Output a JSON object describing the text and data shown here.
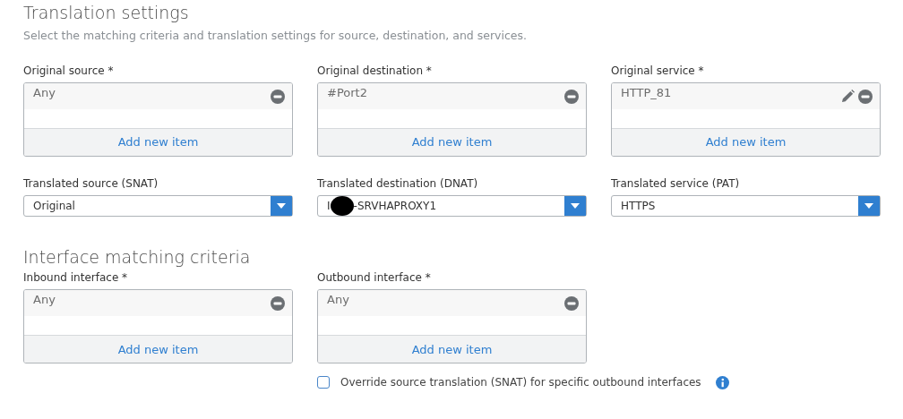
{
  "translation": {
    "title": "Translation settings",
    "description": "Select the matching criteria and translation settings for source, destination, and services.",
    "lists": [
      {
        "label": "Original source *",
        "items": [
          {
            "value": "Any",
            "editable": false
          }
        ],
        "add_label": "Add new item"
      },
      {
        "label": "Original destination *",
        "items": [
          {
            "value": "#Port2",
            "editable": false
          }
        ],
        "add_label": "Add new item"
      },
      {
        "label": "Original service *",
        "items": [
          {
            "value": "HTTP_81",
            "editable": true
          }
        ],
        "add_label": "Add new item"
      }
    ],
    "selects": [
      {
        "label": "Translated source (SNAT)",
        "value": "Original",
        "redacted": false
      },
      {
        "label": "Translated destination (DNAT)",
        "value": "I",
        "redacted": true,
        "value_after": "-SRVHAPROXY1"
      },
      {
        "label": "Translated service (PAT)",
        "value": "HTTPS",
        "redacted": false
      }
    ]
  },
  "interface": {
    "title": "Interface matching criteria",
    "lists": [
      {
        "label": "Inbound interface *",
        "items": [
          {
            "value": "Any",
            "editable": false
          }
        ],
        "add_label": "Add new item"
      },
      {
        "label": "Outbound interface *",
        "items": [
          {
            "value": "Any",
            "editable": false
          }
        ],
        "add_label": "Add new item"
      }
    ],
    "override": {
      "label": "Override source translation (SNAT) for specific outbound interfaces",
      "checked": false
    }
  }
}
